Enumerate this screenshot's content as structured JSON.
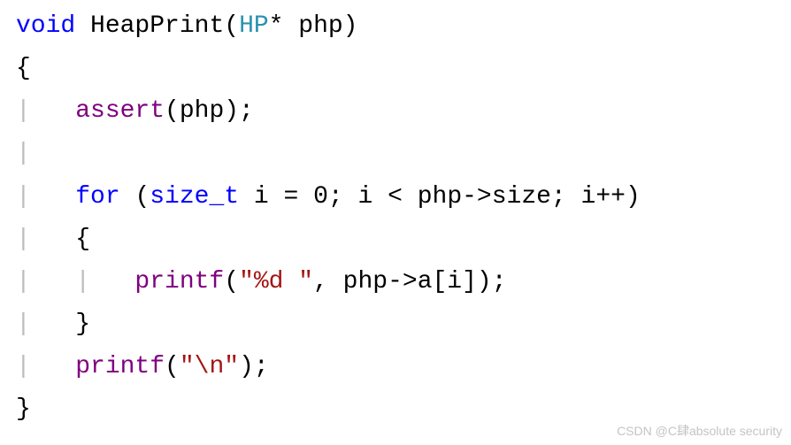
{
  "code": {
    "kw_void": "void",
    "fn_name": " HeapPrint",
    "sig_open": "(",
    "type_hp": "HP",
    "sig_rest": "* php)",
    "brace_open": "{",
    "assert_indent_guide": "|   ",
    "fn_assert": "assert",
    "assert_call": "(php);",
    "blank_guide": "|",
    "for_indent_guide": "|   ",
    "kw_for": "for",
    "for_open": " (",
    "type_size_t": "size_t",
    "for_decl": " i = 0; i < php->size; i++)",
    "inner_brace_open_guide": "|   ",
    "inner_brace_open": "{",
    "printf1_guide": "|   |   ",
    "fn_printf1": "printf",
    "printf1_open": "(",
    "str_fmt1": "\"%d \"",
    "printf1_rest": ", php->a[i]);",
    "inner_brace_close_guide": "|   ",
    "inner_brace_close": "}",
    "printf2_guide": "|   ",
    "fn_printf2": "printf",
    "printf2_open": "(",
    "str_fmt2": "\"\\n\"",
    "printf2_rest": ");",
    "brace_close": "}"
  },
  "watermark": "CSDN @C肆absolute security"
}
